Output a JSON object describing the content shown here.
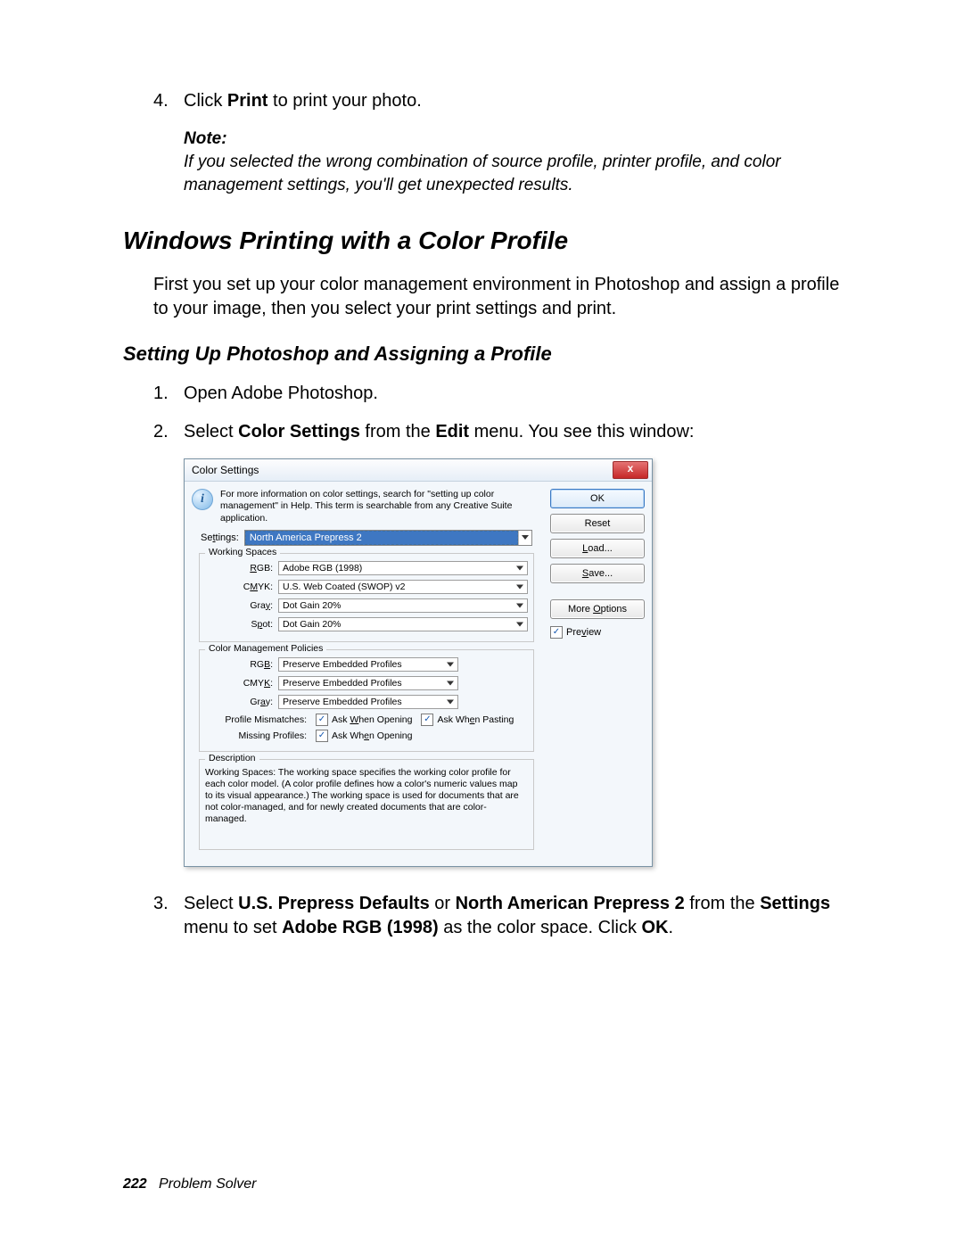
{
  "step4": {
    "num": "4.",
    "pre": "Click ",
    "bold": "Print",
    "post": " to print your photo."
  },
  "note": {
    "head": "Note:",
    "body": "If you selected the wrong combination of source profile, printer profile, and color management settings, you'll get unexpected results."
  },
  "heading": "Windows Printing with a Color Profile",
  "intro": "First you set up your color management environment in Photoshop and assign a profile to your image, then you select your print settings and print.",
  "subheading": "Setting Up Photoshop and Assigning a Profile",
  "step1": {
    "num": "1.",
    "text": "Open Adobe Photoshop."
  },
  "step2": {
    "num": "2.",
    "pre": "Select ",
    "b1": "Color Settings",
    "mid": " from the ",
    "b2": "Edit",
    "post": " menu. You see this window:"
  },
  "step3": {
    "num": "3.",
    "pre": "Select ",
    "b1": "U.S. Prepress Defaults",
    "or": " or ",
    "b2": "North American Prepress 2",
    "mid": " from the ",
    "b3": "Settings",
    "mid2": " menu to set ",
    "b4": "Adobe RGB (1998)",
    "mid3": " as the color space. Click ",
    "b5": "OK",
    "post": "."
  },
  "dialog": {
    "title": "Color Settings",
    "close": "x",
    "info": "For more information on color settings, search for \"setting up color management\" in Help. This term is searchable from any Creative Suite application.",
    "settingsLabel": "Settings:",
    "settingsValue": "North America Prepress 2",
    "ws": {
      "title": "Working Spaces",
      "rgbL": "RGB:",
      "rgbV": "Adobe RGB (1998)",
      "cmykL": "CMYK:",
      "cmykV": "U.S. Web Coated (SWOP) v2",
      "grayL": "Gray:",
      "grayV": "Dot Gain 20%",
      "spotL": "Spot:",
      "spotV": "Dot Gain 20%"
    },
    "cmp": {
      "title": "Color Management Policies",
      "rgbL": "RGB:",
      "rgbV": "Preserve Embedded Profiles",
      "cmykL": "CMYK:",
      "cmykV": "Preserve Embedded Profiles",
      "grayL": "Gray:",
      "grayV": "Preserve Embedded Profiles",
      "pmL": "Profile Mismatches:",
      "mpL": "Missing Profiles:",
      "askOpen": "Ask When Opening",
      "askPaste": "Ask When Pasting"
    },
    "desc": {
      "title": "Description",
      "text": "Working Spaces:  The working space specifies the working color profile for each color model.  (A color profile defines how a color's numeric values map to its visual appearance.)  The working space is used for documents that are not color-managed, and for newly created documents that are color-managed."
    },
    "btn": {
      "ok": "OK",
      "reset": "Reset",
      "load": "Load...",
      "save": "Save...",
      "more": "More Options",
      "preview": "Preview"
    }
  },
  "footer": {
    "page": "222",
    "section": "Problem Solver"
  }
}
